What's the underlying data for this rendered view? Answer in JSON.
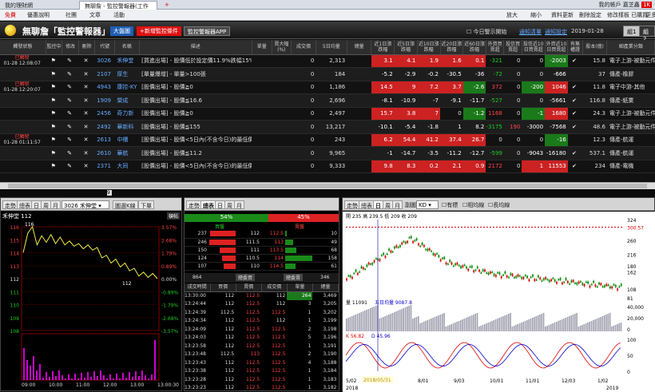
{
  "browser": {
    "tab1": "我的理財網",
    "tab2": "無聊詹 - 監控警報器(工作",
    "new_tab": "+",
    "right_label": "我的帳戶",
    "right_user": "嘉芝鑫",
    "badge": "1K"
  },
  "toolbar": {
    "left": [
      "免費",
      "優惠說明",
      "社團",
      "文章",
      "活動"
    ],
    "right": [
      "放大",
      "縮小",
      "資料更新",
      "刪除設定",
      "修改樣板",
      "已購買",
      "更多"
    ]
  },
  "header": {
    "title": "無聊詹「監控警報器」",
    "market_btn": "大盤圖",
    "add_btn": "+新增監控條件",
    "app_btn": "監控警報器APP",
    "today_chk": "今日警示開始",
    "link1": "通知清單",
    "link2": "通知設定",
    "date": "2019-01-28",
    "group1": "組1",
    "group2": "組2"
  },
  "columns": [
    "觸發狀態",
    "監控中",
    "修改",
    "刪除",
    "代號",
    "名稱",
    "描述",
    "單量",
    "賣大幅(%)",
    "成交價",
    "5日均量",
    "總量",
    "近1日漲跌幅",
    "近5日漲跌幅",
    "近10日漲跌幅",
    "近20日漲跌幅",
    "近60日漲跌幅",
    "外資買賣超",
    "投信買賣超",
    "投信近10日買賣超",
    "外資近10日買賣超",
    "有無權證",
    "股本(億)",
    "細產業分類"
  ],
  "rows": [
    {
      "status": "已觸發",
      "time": "01-28 12:08:07",
      "code": "3026",
      "name": "禾伸堂",
      "desc": "[買進出場] - 股價低於設定價11.9%跌幅15%",
      "qty": "",
      "r": "",
      "price": "0",
      "avg5": "2,313",
      "vol": "",
      "c1": "3.1",
      "c5": "4.1",
      "c10": "1.9",
      "c20": "1.6",
      "c60": "0.1",
      "fi": "-321",
      "it": "0",
      "it10": "0",
      "fi10": "-2003",
      "w": "✔",
      "cap": "15.8",
      "ind": "電子上游-被動元件"
    },
    {
      "status": "",
      "time": "",
      "code": "2107",
      "name": "厚生",
      "desc": "[單量爆增] - 單量>100張",
      "qty": "",
      "r": "",
      "price": "0",
      "avg5": "184",
      "vol": "",
      "c1": "-5.2",
      "c5": "-2.9",
      "c10": "-0.2",
      "c20": "-30.5",
      "c60": "-36",
      "fi": "-72",
      "it": "0",
      "it10": "0",
      "fi10": "-666",
      "w": "",
      "cap": "37",
      "ind": "傳產-橡膠"
    },
    {
      "status": "已觸發",
      "time": "01-28 12:20:07",
      "code": "4943",
      "name": "康控-KY",
      "desc": "[股價出場] - 股價≧0",
      "qty": "",
      "r": "",
      "price": "0",
      "avg5": "1,186",
      "vol": "",
      "c1": "14.5",
      "c5": "9",
      "c10": "7.2",
      "c20": "3.7",
      "c60": "-2.6",
      "fi": "372",
      "it": "0",
      "it10": "-200",
      "fi10": "1046",
      "w": "✔",
      "cap": "11.8",
      "ind": "電子中游-其他"
    },
    {
      "status": "",
      "time": "",
      "code": "1909",
      "name": "榮成",
      "desc": "[股價出場] - 股價≦16.6",
      "qty": "",
      "r": "",
      "price": "0",
      "avg5": "2,696",
      "vol": "",
      "c1": "-8.1",
      "c5": "-10.9",
      "c10": "-7",
      "c20": "-9.1",
      "c60": "-11.7",
      "fi": "-527",
      "it": "0",
      "it10": "0",
      "fi10": "-5661",
      "w": "✔",
      "cap": "116.8",
      "ind": "傳產-紙業"
    },
    {
      "status": "",
      "time": "",
      "code": "2456",
      "name": "奇力新",
      "desc": "[股價出場] - 股價≧0",
      "qty": "",
      "r": "",
      "price": "0",
      "avg5": "2,497",
      "vol": "",
      "c1": "15.7",
      "c5": "3.8",
      "c10": "7",
      "c20": "0",
      "c60": "-1.2",
      "fi": "1168",
      "it": "0",
      "it10": "-1",
      "fi10": "1680",
      "w": "✔",
      "cap": "24.3",
      "ind": "電子上游-被動元件"
    },
    {
      "status": "",
      "time": "",
      "code": "2492",
      "name": "華新科",
      "desc": "[股價出場] - 股價≦155",
      "qty": "",
      "r": "",
      "price": "0",
      "avg5": "13,217",
      "vol": "",
      "c1": "-10.1",
      "c5": "-5.4",
      "c10": "-1.8",
      "c20": "1",
      "c60": "8.2",
      "fi": "-3175",
      "it": "190",
      "it10": "-3000",
      "fi10": "-7568",
      "w": "✔",
      "cap": "48.6",
      "ind": "電子上游-被動元件"
    },
    {
      "status": "已觸發",
      "time": "01-28 01:11:57",
      "code": "2613",
      "name": "中櫃",
      "desc": "[股價出場] - 股價<5日內(不含今日)的最低價",
      "qty": "",
      "r": "",
      "price": "0",
      "avg5": "243",
      "vol": "",
      "c1": "6.2",
      "c5": "54.4",
      "c10": "41.2",
      "c20": "37.4",
      "c60": "26.7",
      "fi": "0",
      "it": "0",
      "it10": "0",
      "fi10": "-16",
      "w": "",
      "cap": "12.3",
      "ind": "傳產-航運"
    },
    {
      "status": "",
      "time": "",
      "code": "2610",
      "name": "華航",
      "desc": "[股價出場] - 股價≦11.2",
      "qty": "",
      "r": "",
      "price": "0",
      "avg5": "9,965",
      "vol": "",
      "c1": "-1",
      "c5": "-14.7",
      "c10": "-3.5",
      "c20": "-11.2",
      "c60": "-12.7",
      "fi": "-599",
      "it": "0",
      "it10": "-9043",
      "fi10": "-16180",
      "w": "✔",
      "cap": "537.1",
      "ind": "傳產-航運"
    },
    {
      "status": "",
      "time": "",
      "code": "2371",
      "name": "大同",
      "desc": "[股價出場] - 股價<5日內(不含今日)的最低價",
      "qty": "",
      "r": "",
      "price": "0",
      "avg5": "9,333",
      "vol": "",
      "c1": "9.8",
      "c5": "8.3",
      "c10": "0.2",
      "c20": "2.1",
      "c60": "0.9",
      "fi": "2172",
      "it": "0",
      "it10": "1",
      "fi10": "11553",
      "w": "✔",
      "cap": "234",
      "ind": "傳產-電機"
    }
  ],
  "scroll_value": "9",
  "intraday": {
    "tabs": [
      "走勢",
      "總表",
      "日",
      "周",
      "月"
    ],
    "stock_select": "3026 禾伸堂",
    "btn1": "圖選K線",
    "btn2": "下單",
    "stock_label": "禾伸堂 112",
    "pin": "頓帖",
    "high_label": "116",
    "low_label": "112",
    "y_left": [
      "116",
      "115",
      "114",
      "113",
      "112",
      "111",
      "110",
      "109",
      "108"
    ],
    "y_right": [
      "3.57%",
      "2.68%",
      "1.79%",
      "0.89%",
      "0.00%",
      "-0.89%",
      "-1.79%",
      "-2.68%",
      "-3.57%"
    ],
    "x": [
      "09:00",
      "10:00",
      "11:00",
      "12:00",
      "13:00",
      "13:00:30"
    ]
  },
  "orderbook": {
    "tabs": [
      "走勢",
      "總表",
      "日",
      "周",
      "月"
    ],
    "buy_pct": "54%",
    "sell_pct": "45%",
    "buy_label": "買盤",
    "sell_label": "賣盤",
    "rows": [
      [
        "237",
        "112",
        "112.5",
        "10"
      ],
      [
        "246",
        "111.5",
        "113",
        "49"
      ],
      [
        "150",
        "111",
        "113.5",
        "68"
      ],
      [
        "124",
        "110.5",
        "114",
        "158"
      ],
      [
        "107",
        "110",
        "114.5",
        "61"
      ]
    ],
    "buy_total": "864",
    "buy_total_label": "總委買",
    "sell_total_label": "總委賣",
    "sell_total": "346",
    "tick_headers": [
      "成交時間",
      "買價",
      "賣價",
      "成交價",
      "單量",
      "總量"
    ],
    "ticks": [
      [
        "13:30:00",
        "112",
        "112.5",
        "112",
        "264",
        "3,469"
      ],
      [
        "13:24:44",
        "112",
        "112.5",
        "112",
        "3",
        "3,205"
      ],
      [
        "13:24:39",
        "112.5",
        "112.5",
        "112.5",
        "1",
        "3,202"
      ],
      [
        "13:24:34",
        "112",
        "112.5",
        "112",
        "1",
        "3,199"
      ],
      [
        "13:24:09",
        "112",
        "112.5",
        "112.5",
        "2",
        "3,198"
      ],
      [
        "13:24:03",
        "112",
        "112.5",
        "112.5",
        "5",
        "3,196"
      ],
      [
        "13:23:58",
        "112",
        "112.5",
        "112.5",
        "1",
        "3,191"
      ],
      [
        "13:23:48",
        "112.5",
        "113",
        "112.5",
        "2",
        "3,190"
      ],
      [
        "13:23:43",
        "112",
        "112.5",
        "112.5",
        "4",
        "3,188"
      ],
      [
        "13:23:38",
        "112",
        "112.5",
        "112.5",
        "1",
        "3,184"
      ],
      [
        "13:23:28",
        "112",
        "112.5",
        "112.5",
        "1",
        "3,183"
      ],
      [
        "13:23:23",
        "112",
        "112.5",
        "112.5",
        "1",
        "3,182"
      ]
    ]
  },
  "kline": {
    "tabs": [
      "走勢",
      "總表",
      "日",
      "周",
      "月"
    ],
    "sub_label": "副圖",
    "sub_select": "KD",
    "chk1": "有標",
    "chk2": "相均線",
    "chk3": "長均線",
    "price_info": "開 235  高 239.5  低 209  收 209",
    "vol_info": "量 11091",
    "avg5_info": "五日均量 9087.8",
    "kd_k": "K 56.82",
    "kd_d": "D 45.96",
    "y_price": [
      "324",
      "300.57",
      "260",
      "216",
      "180",
      "162",
      "108",
      "81"
    ],
    "y_vol": [
      "40,000",
      "20,000",
      "0"
    ],
    "y_kd": [
      "100",
      "50",
      "0"
    ],
    "x": [
      "5/02",
      "7/02",
      "8/01",
      "9/03",
      "10/01",
      "11/01",
      "12/03",
      "1/02"
    ],
    "year_l": "2018",
    "year_r": "2019",
    "date_tag": "2018/05/31"
  }
}
